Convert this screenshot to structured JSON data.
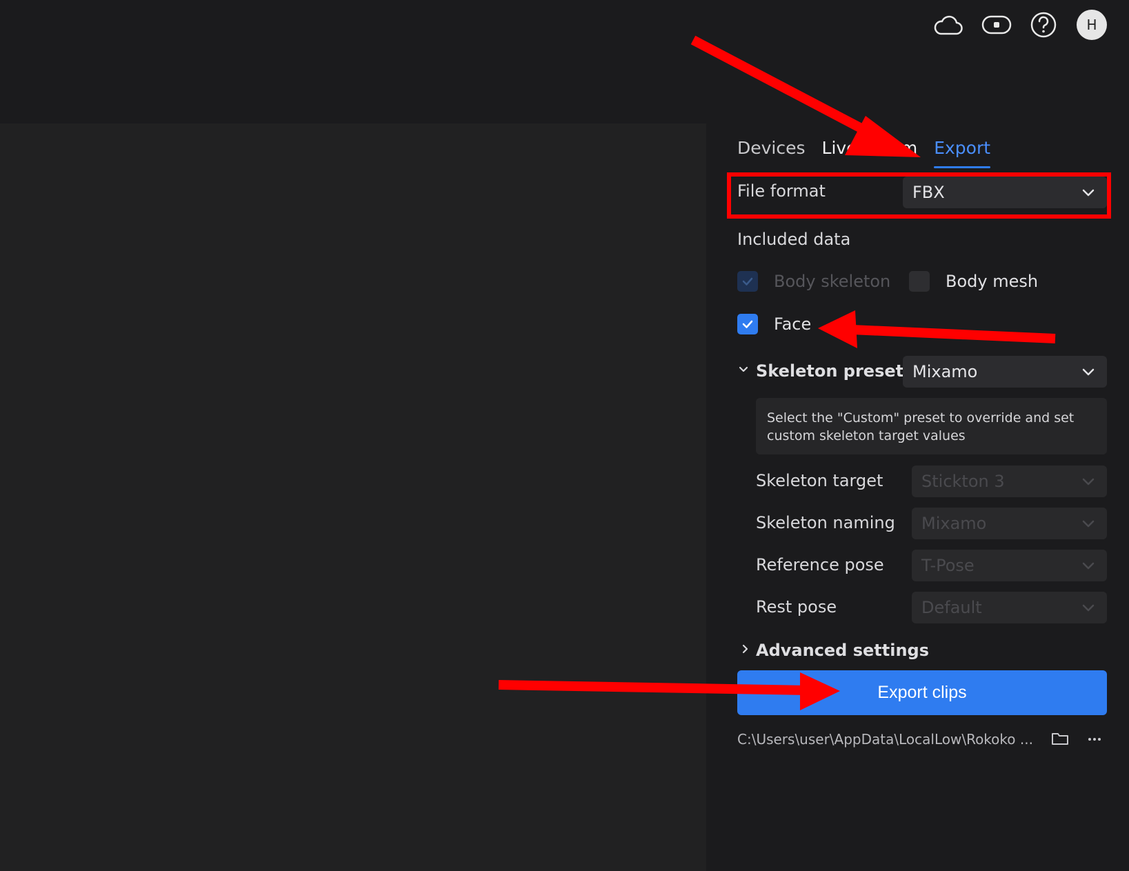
{
  "header": {
    "icons": [
      "cloud-icon",
      "toggle-icon",
      "help-icon"
    ],
    "avatar_initial": "H"
  },
  "tabs": [
    {
      "label": "Devices"
    },
    {
      "label": "Livestream"
    },
    {
      "label": "Export",
      "selected": true
    }
  ],
  "file_format": {
    "label": "File format",
    "value": "FBX"
  },
  "included_data": {
    "label": "Included data",
    "options": [
      {
        "label": "Body skeleton",
        "checked": true,
        "disabled": true
      },
      {
        "label": "Body mesh",
        "checked": false,
        "disabled": false
      },
      {
        "label": "Face",
        "checked": true,
        "disabled": false
      }
    ]
  },
  "skeleton_preset": {
    "label": "Skeleton preset",
    "value": "Mixamo",
    "info": "Select the \"Custom\" preset to override and set custom skeleton target values",
    "fields": [
      {
        "label": "Skeleton target",
        "value": "Stickton 3"
      },
      {
        "label": "Skeleton naming",
        "value": "Mixamo"
      },
      {
        "label": "Reference pose",
        "value": "T-Pose"
      },
      {
        "label": "Rest pose",
        "value": "Default"
      }
    ]
  },
  "advanced_settings": {
    "label": "Advanced settings"
  },
  "export_button": {
    "label": "Export clips"
  },
  "export_path": "C:\\Users\\user\\AppData\\LocalLow\\Rokoko ...",
  "colors": {
    "accent": "#2f7cf0",
    "annotation": "#ff0000",
    "panel_bg": "#1b1b1d",
    "viewport_bg": "#212122"
  }
}
